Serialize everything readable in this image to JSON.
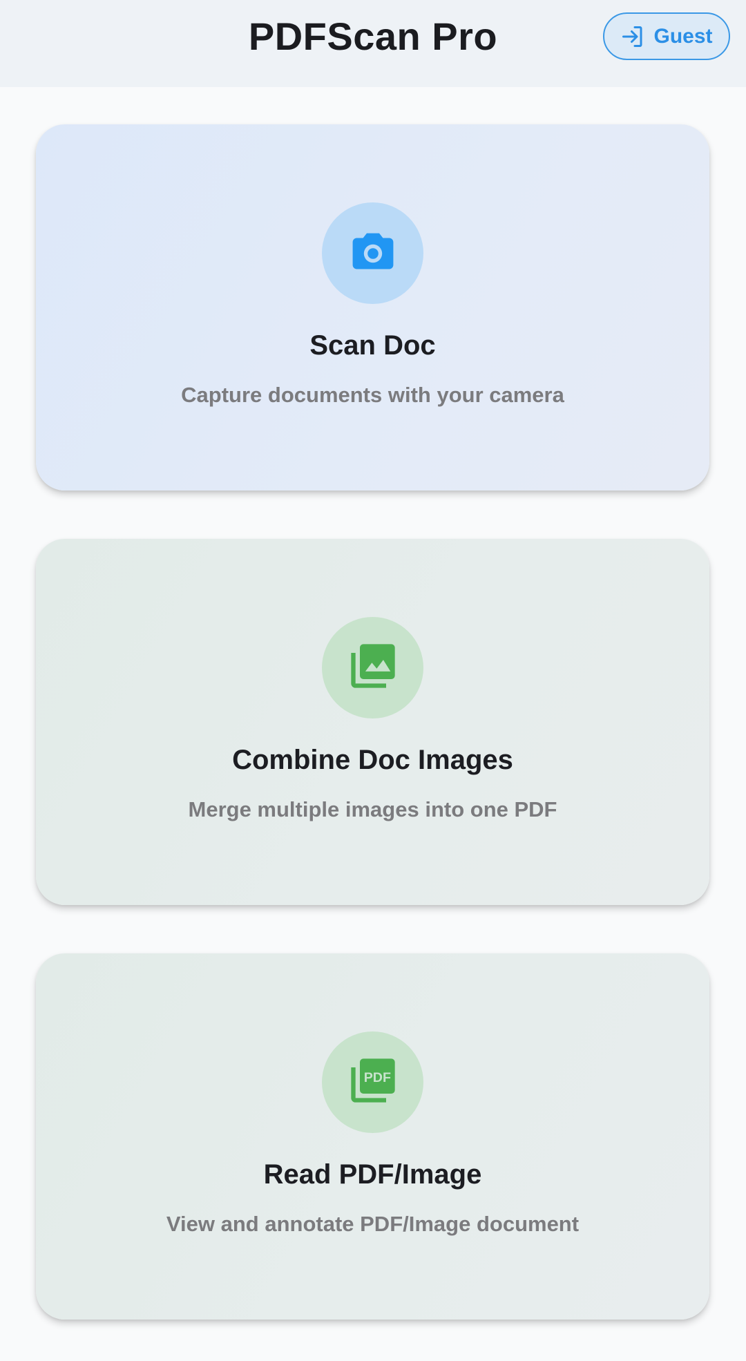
{
  "header": {
    "title": "PDFScan Pro",
    "guest_button": {
      "label": "Guest",
      "icon": "login-icon"
    }
  },
  "cards": [
    {
      "title": "Scan Doc",
      "description": "Capture documents with your camera",
      "icon": "camera-icon",
      "accent": "#2196f3"
    },
    {
      "title": "Combine Doc Images",
      "description": "Merge multiple images into one PDF",
      "icon": "photo-library-icon",
      "accent": "#4caf50"
    },
    {
      "title": "Read PDF/Image",
      "description": "View and annotate PDF/Image document",
      "icon": "pdf-icon",
      "icon_text": "PDF",
      "accent": "#4caf50"
    }
  ],
  "colors": {
    "header_bg": "#eef2f6",
    "page_bg": "#f9fafb",
    "guest_border": "#3a98e6",
    "guest_text": "#2b8fe6"
  }
}
